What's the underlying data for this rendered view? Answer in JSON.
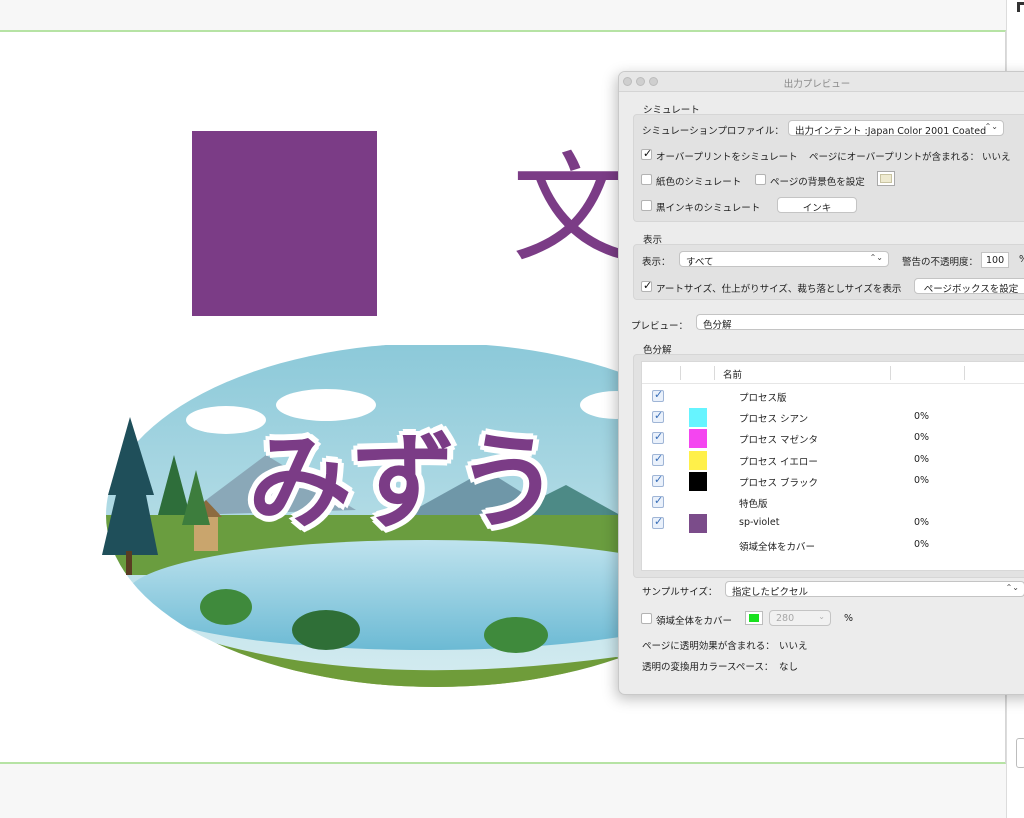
{
  "canvas": {
    "big_kanji": "文",
    "scene_text": "みずう"
  },
  "panel": {
    "title": "出力プレビュー",
    "simulate": {
      "section": "シミュレート",
      "profile_label": "シミュレーションプロファイル：",
      "profile_value": "出力インテント :Japan Color 2001 Coated",
      "overprint_label": "オーバープリントをシミュレート",
      "overprint_checked": true,
      "page_overprint_label": "ページにオーバープリントが含まれる：",
      "page_overprint_value": "いいえ",
      "paper_color_label": "紙色のシミュレート",
      "page_bg_label": "ページの背景色を設定",
      "black_ink_label": "黒インキのシミュレート",
      "ink_button": "インキ"
    },
    "display": {
      "section": "表示",
      "show_label": "表示：",
      "show_value": "すべて",
      "warn_opacity_label": "警告の不透明度：",
      "warn_opacity_value": "100",
      "warn_opacity_unit": "%",
      "art_size_label": "アートサイズ、仕上がりサイズ、裁ち落としサイズを表示",
      "art_size_checked": true,
      "page_box_button": "ページボックスを設定"
    },
    "preview": {
      "label": "プレビュー：",
      "value": "色分解"
    },
    "separations": {
      "section": "色分解",
      "col_name": "名前",
      "rows": [
        {
          "name": "プロセス版",
          "pct": "",
          "color": ""
        },
        {
          "name": "プロセス シアン",
          "pct": "0%",
          "color": "#66f4ff"
        },
        {
          "name": "プロセス マゼンタ",
          "pct": "0%",
          "color": "#f445f0"
        },
        {
          "name": "プロセス イエロー",
          "pct": "0%",
          "color": "#fff04a"
        },
        {
          "name": "プロセス ブラック",
          "pct": "0%",
          "color": "#000000"
        },
        {
          "name": "特色版",
          "pct": "",
          "color": ""
        },
        {
          "name": "sp-violet",
          "pct": "0%",
          "color": "#7b4c8a"
        },
        {
          "name": "領域全体をカバー",
          "pct": "0%",
          "color": ""
        }
      ]
    },
    "sample": {
      "label": "サンプルサイズ：",
      "value": "指定したピクセル"
    },
    "coverage": {
      "label": "領域全体をカバー",
      "value": "280",
      "unit": "%"
    },
    "transparency": {
      "label": "ページに透明効果が含まれる：",
      "value": "いいえ"
    },
    "blend_space": {
      "label": "透明の変換用カラースペース：",
      "value": "なし"
    }
  }
}
